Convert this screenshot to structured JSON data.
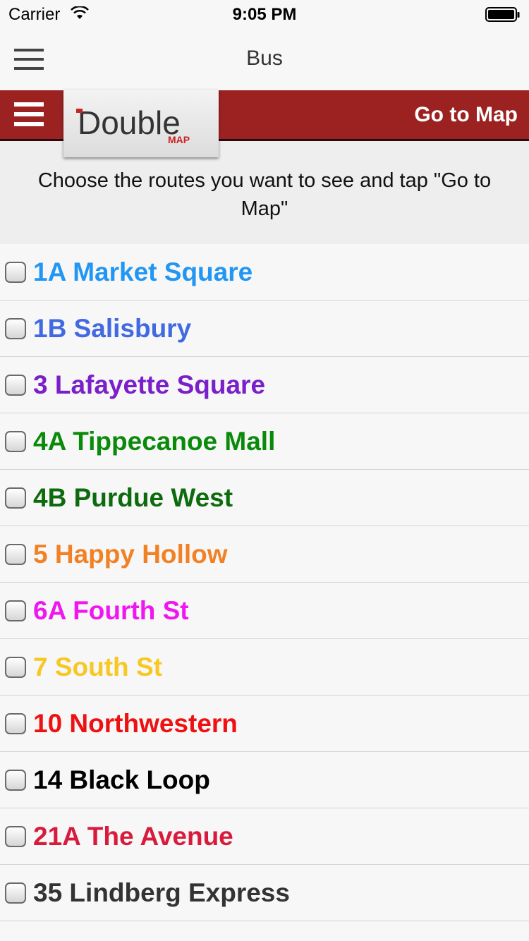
{
  "status_bar": {
    "carrier": "Carrier",
    "time": "9:05 PM"
  },
  "nav": {
    "title": "Bus",
    "menu_icon": "hamburger-icon"
  },
  "header": {
    "menu_icon": "hamburger-icon",
    "logo_text": "Double",
    "logo_subtext": "MAP",
    "go_to_map": "Go to Map",
    "colors": {
      "bar": "#9c2222"
    }
  },
  "instructions": "Choose the routes you want to see and tap \"Go to Map\"",
  "routes": [
    {
      "label": "1A Market Square",
      "color": "#2196f3",
      "checked": false
    },
    {
      "label": "1B Salisbury",
      "color": "#4169e1",
      "checked": false
    },
    {
      "label": "3 Lafayette Square",
      "color": "#7a1fc9",
      "checked": false
    },
    {
      "label": "4A Tippecanoe Mall",
      "color": "#0a8a0a",
      "checked": false
    },
    {
      "label": "4B Purdue West",
      "color": "#0d6b0d",
      "checked": false
    },
    {
      "label": "5 Happy Hollow",
      "color": "#f28126",
      "checked": false
    },
    {
      "label": "6A Fourth St",
      "color": "#f016f0",
      "checked": false
    },
    {
      "label": "7 South St",
      "color": "#f7c823",
      "checked": false
    },
    {
      "label": "10 Northwestern",
      "color": "#ee1111",
      "checked": false
    },
    {
      "label": "14 Black Loop",
      "color": "#000000",
      "checked": false
    },
    {
      "label": "21A The Avenue",
      "color": "#d81b3c",
      "checked": false
    },
    {
      "label": "35 Lindberg Express",
      "color": "#333333",
      "checked": false
    }
  ]
}
